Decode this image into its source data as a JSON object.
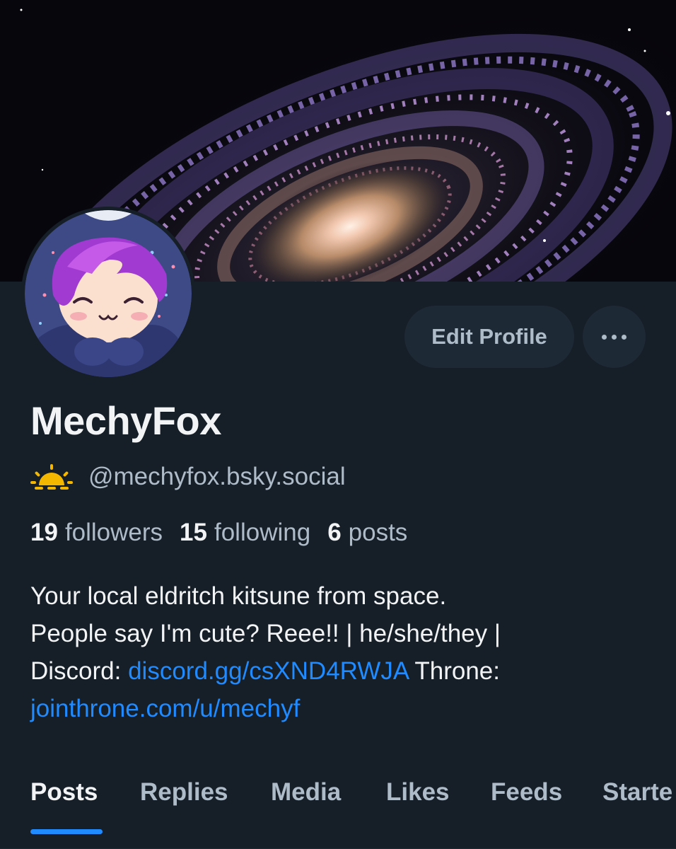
{
  "profile": {
    "display_name": "MechyFox",
    "handle": "@mechyfox.bsky.social",
    "handle_icon": "sun-icon",
    "followers_count": "19",
    "followers_label": "followers",
    "following_count": "15",
    "following_label": "following",
    "posts_count": "6",
    "posts_label": "posts",
    "bio": {
      "line1": "Your local eldritch kitsune from space.",
      "line2": "People say I'm cute? Reee!! | he/she/they |",
      "line3_prefix": "Discord: ",
      "discord_link": "discord.gg/csXND4RWJA",
      "line3_suffix": " Throne:",
      "throne_link": "jointhrone.com/u/mechyf"
    }
  },
  "actions": {
    "edit_label": "Edit Profile",
    "more_icon": "ellipsis-icon"
  },
  "tabs": [
    {
      "label": "Posts",
      "active": true
    },
    {
      "label": "Replies",
      "active": false
    },
    {
      "label": "Media",
      "active": false
    },
    {
      "label": "Likes",
      "active": false
    },
    {
      "label": "Feeds",
      "active": false
    },
    {
      "label": "Starte",
      "active": false
    }
  ],
  "colors": {
    "background": "#161e27",
    "accent": "#208bfe",
    "button_bg": "#1e2936",
    "muted_text": "#aebbc9",
    "primary_text": "#f1f3f5",
    "handle_icon": "#f5b800"
  }
}
